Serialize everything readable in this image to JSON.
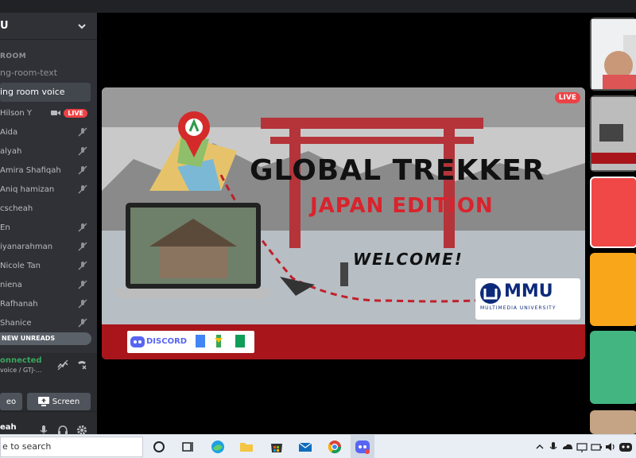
{
  "server": {
    "name": "U"
  },
  "channels": {
    "category": "ROOM",
    "text_channel": "ng-room-text",
    "voice_channel": "ing room voice"
  },
  "users": [
    {
      "name": "Hilson Y",
      "live": "LIVE"
    },
    {
      "name": "Aida"
    },
    {
      "name": "alyah"
    },
    {
      "name": "Amira Shafiqah"
    },
    {
      "name": "Aniq hamizan"
    },
    {
      "name": "cscheah"
    },
    {
      "name": "En"
    },
    {
      "name": "iyanarahman"
    },
    {
      "name": "Nicole Tan"
    },
    {
      "name": "niena"
    },
    {
      "name": "Rafhanah"
    },
    {
      "name": "Shanice"
    }
  ],
  "banner": {
    "new_unreads": "NEW UNREADS"
  },
  "voice": {
    "status": "onnected",
    "sub": "voice / GTJ-...",
    "video_label": "eo",
    "screen_label": "Screen"
  },
  "user_panel": {
    "name": "eah"
  },
  "slide": {
    "live": "LIVE",
    "title": "GLOBAL TREKKER",
    "subtitle": "JAPAN EDITION",
    "welcome": "WELCOME!",
    "logo_text": "MMU",
    "logo_sub": "MULTIMEDIA UNIVERSITY",
    "discord_text": "DISCORD"
  },
  "taskbar": {
    "search_placeholder": "e to search"
  },
  "colors": {
    "accent_red": "#ed4245",
    "connected_green": "#3ba55d",
    "tile_red": "#f04747",
    "tile_orange": "#faa61a",
    "tile_green": "#43b581",
    "tile_tan": "#c4a484"
  },
  "icons": [
    "chevron-down-icon",
    "camera-icon",
    "mic-off-icon",
    "signal-icon",
    "disconnect-icon",
    "screen-share-icon",
    "microphone-icon",
    "headphones-icon",
    "gear-icon",
    "cortana-icon",
    "task-view-icon",
    "edge-icon",
    "folder-icon",
    "store-icon",
    "mail-icon",
    "chrome-icon",
    "discord-icon"
  ]
}
